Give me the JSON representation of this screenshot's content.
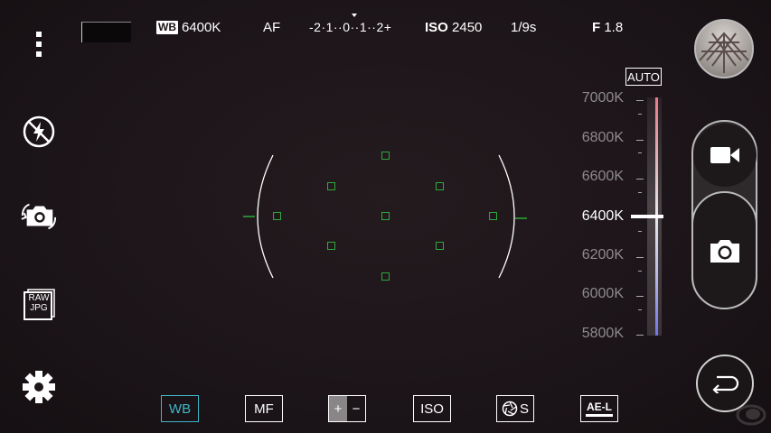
{
  "top_bar": {
    "wb_tag": "WB",
    "wb_value": "6400K",
    "focus_mode": "AF",
    "ev_scale": "-2·1··0··1··2+",
    "iso_tag": "ISO",
    "iso_value": "2450",
    "shutter": "1/9s",
    "aperture_tag": "F",
    "aperture_value": "1.8"
  },
  "left_menu": {
    "icons": [
      "more-vert-icon",
      "flash-off-icon",
      "switch-camera-icon",
      "raw-jpg-icon",
      "settings-icon"
    ],
    "raw_label": "RAW",
    "jpg_label": "JPG"
  },
  "wb_scale": {
    "auto_label": "AUTO",
    "labels": [
      "7000K",
      "6800K",
      "6600K",
      "6400K",
      "6200K",
      "6000K",
      "5800K"
    ],
    "selected": "6400K",
    "level_fraction": 0.5
  },
  "right_panel": {
    "icons": [
      "gallery-thumbnail",
      "video-record-icon",
      "photo-capture-icon",
      "back-icon"
    ]
  },
  "bottom_bar": {
    "wb": "WB",
    "mf": "MF",
    "ev_plus": "+",
    "ev_minus": "−",
    "iso": "ISO",
    "shutter_letter": "S",
    "ae_lock": "AE-L",
    "active": "WB",
    "active_color": "#3fb8c8"
  }
}
